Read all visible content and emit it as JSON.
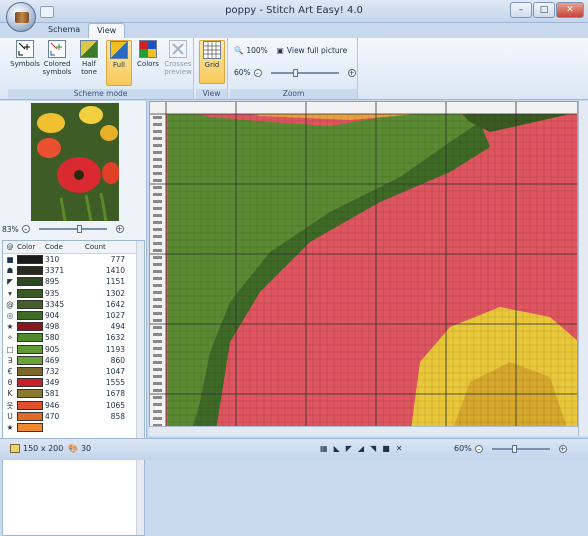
{
  "window": {
    "title": "poppy - Stitch Art Easy! 4.0",
    "controls": [
      "minimize",
      "maximize",
      "close"
    ]
  },
  "tabs": [
    {
      "label": "Schema",
      "active": false
    },
    {
      "label": "View",
      "active": true
    }
  ],
  "ribbon": {
    "scheme_mode": {
      "label": "Scheme mode",
      "buttons": [
        {
          "label": "Symbols",
          "pressed": false
        },
        {
          "label": "Colored symbols",
          "pressed": false
        },
        {
          "label": "Half tone",
          "pressed": false
        },
        {
          "label": "Full",
          "pressed": true
        },
        {
          "label": "Colors",
          "pressed": false
        },
        {
          "label": "Crosses preview",
          "pressed": false,
          "disabled": true
        }
      ]
    },
    "view": {
      "label": "View",
      "grid_label": "Grid"
    },
    "zoom": {
      "label": "Zoom",
      "reset_label": "100%",
      "fit_label": "View full picture",
      "value": "60%"
    }
  },
  "preview": {
    "zoom": "83%"
  },
  "palette": {
    "headers": [
      "@",
      "Color",
      "Code",
      "Count"
    ],
    "rows": [
      {
        "symbol": "■",
        "color": "#1a1a18",
        "code": "310",
        "count": "777"
      },
      {
        "symbol": "☗",
        "color": "#2a2a20",
        "code": "3371",
        "count": "1410"
      },
      {
        "symbol": "◤",
        "color": "#2f4a22",
        "code": "895",
        "count": "1151"
      },
      {
        "symbol": "▾",
        "color": "#3a5a24",
        "code": "935",
        "count": "1302"
      },
      {
        "symbol": "@",
        "color": "#45602a",
        "code": "3345",
        "count": "1642"
      },
      {
        "symbol": "◎",
        "color": "#3d6b25",
        "code": "904",
        "count": "1027"
      },
      {
        "symbol": "★",
        "color": "#8a1620",
        "code": "498",
        "count": "494"
      },
      {
        "symbol": "✧",
        "color": "#4f8a2c",
        "code": "580",
        "count": "1632"
      },
      {
        "symbol": "□",
        "color": "#5f9a32",
        "code": "905",
        "count": "1193"
      },
      {
        "symbol": "∃",
        "color": "#6aa436",
        "code": "469",
        "count": "860"
      },
      {
        "symbol": "€",
        "color": "#7a6a2a",
        "code": "732",
        "count": "1047"
      },
      {
        "symbol": "θ",
        "color": "#c8202a",
        "code": "349",
        "count": "1555"
      },
      {
        "symbol": "K",
        "color": "#8a7a30",
        "code": "581",
        "count": "1678"
      },
      {
        "symbol": "웃",
        "color": "#e0502a",
        "code": "946",
        "count": "1065"
      },
      {
        "symbol": "U",
        "color": "#e06a28",
        "code": "470",
        "count": "858"
      },
      {
        "symbol": "★",
        "color": "#f08a30",
        "code": "",
        "count": ""
      }
    ]
  },
  "status": {
    "size": "150 x 200",
    "colors": "30",
    "zoom": "60%"
  },
  "icons": [
    "app-spool-icon",
    "palette-icon",
    "colors-icon"
  ]
}
